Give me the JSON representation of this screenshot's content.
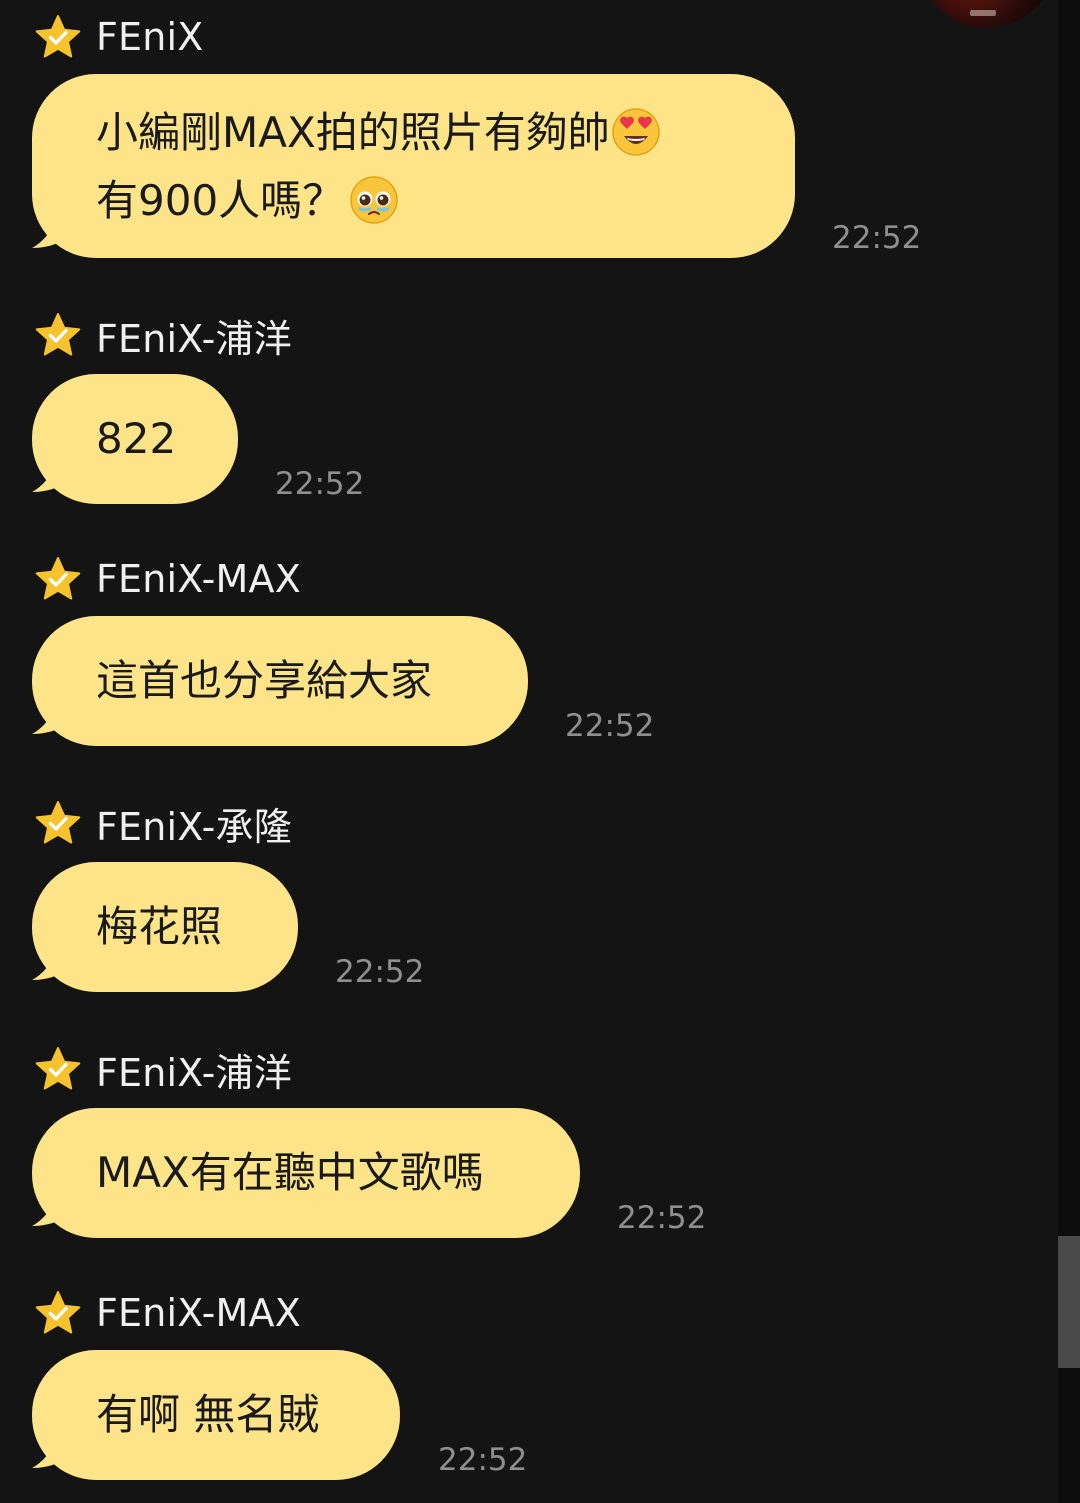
{
  "messages": [
    {
      "sender": "FEniX",
      "lines": [
        "小編剛MAX拍的照片有夠帥",
        "有900人嗎？"
      ],
      "emojis": [
        "heart-eyes-emoji",
        "pleading-face-emoji"
      ],
      "time": "22:52"
    },
    {
      "sender": "FEniX-浦洋",
      "lines": [
        "822"
      ],
      "time": "22:52"
    },
    {
      "sender": "FEniX-MAX",
      "lines": [
        "這首也分享給大家"
      ],
      "time": "22:52"
    },
    {
      "sender": "FEniX-承隆",
      "lines": [
        "梅花照"
      ],
      "time": "22:52"
    },
    {
      "sender": "FEniX-浦洋",
      "lines": [
        "MAX有在聽中文歌嗎"
      ],
      "time": "22:52"
    },
    {
      "sender": "FEniX-MAX",
      "lines": [
        "有啊 無名賊"
      ],
      "time": "22:52"
    }
  ],
  "colors": {
    "background": "#141414",
    "bubble": "#fde488",
    "star": "#f6c32c",
    "timestamp": "#8f8f8f"
  },
  "icons": {
    "sender_badge": "star-check-icon",
    "avatar": "profile-avatar"
  }
}
